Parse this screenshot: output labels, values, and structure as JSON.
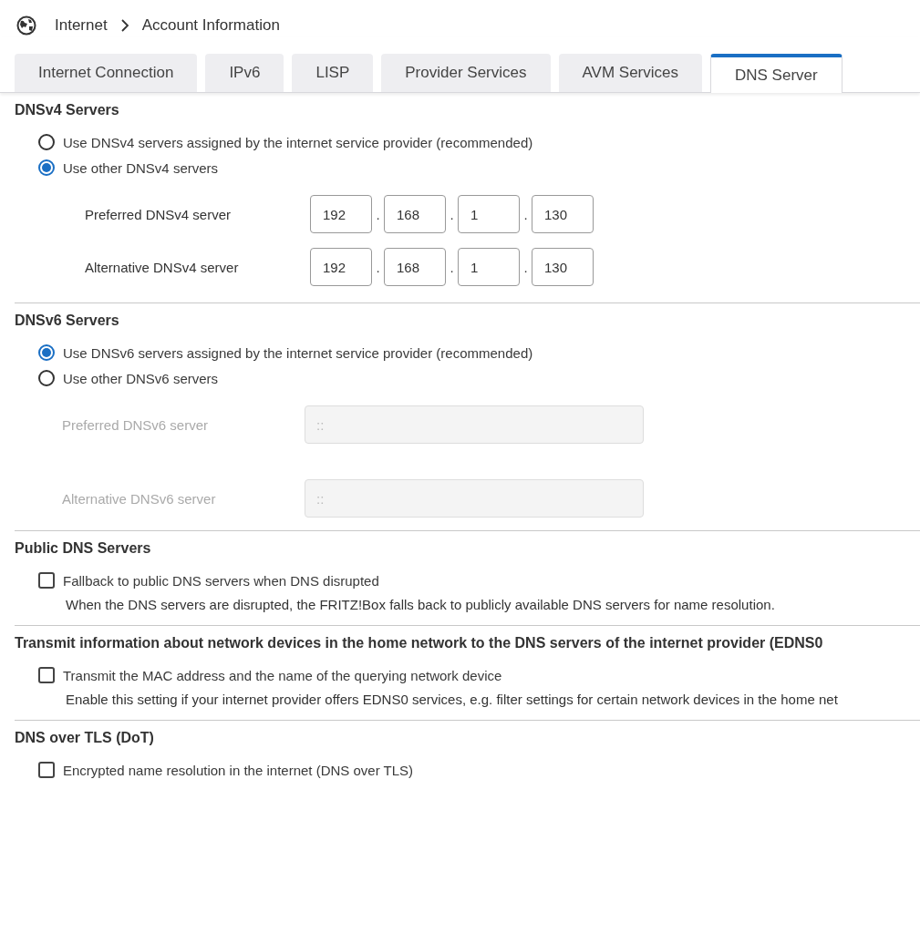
{
  "breadcrumb": [
    "Internet",
    "Account Information"
  ],
  "tabs": [
    {
      "label": "Internet Connection",
      "selected": false
    },
    {
      "label": "IPv6",
      "selected": false
    },
    {
      "label": "LISP",
      "selected": false
    },
    {
      "label": "Provider Services",
      "selected": false
    },
    {
      "label": "AVM Services",
      "selected": false
    },
    {
      "label": "DNS Server",
      "selected": true
    }
  ],
  "sections": [
    {
      "kind": "radio",
      "title": "DNSv4 Servers",
      "options": [
        {
          "label": "Use DNSv4 servers assigned by the internet service provider (recommended)",
          "selected": false
        },
        {
          "label": "Use other DNSv4 servers",
          "selected": true
        }
      ],
      "servers": [
        {
          "kind": "ipv4",
          "label": "Preferred DNSv4 server",
          "disabled": false,
          "octets": [
            "192",
            "168",
            "1",
            "130"
          ],
          "separator": "."
        },
        {
          "kind": "ipv4",
          "label": "Alternative DNSv4 server",
          "disabled": false,
          "octets": [
            "192",
            "168",
            "1",
            "130"
          ],
          "separator": "."
        }
      ]
    },
    {
      "kind": "radio",
      "title": "DNSv6 Servers",
      "options": [
        {
          "label": "Use DNSv6 servers assigned by the internet service provider (recommended)",
          "selected": true
        },
        {
          "label": "Use other DNSv6 servers",
          "selected": false
        }
      ],
      "servers": [
        {
          "kind": "ipv6",
          "label": "Preferred DNSv6 server",
          "disabled": true,
          "placeholder": "::"
        },
        {
          "kind": "ipv6",
          "label": "Alternative DNSv6 server",
          "disabled": true,
          "placeholder": "::"
        }
      ]
    },
    {
      "kind": "checkbox",
      "title": "Public DNS Servers",
      "options": [
        {
          "label": "Fallback to public DNS servers when DNS disrupted",
          "checked": false,
          "description": "When the DNS servers are disrupted, the FRITZ!Box falls back to publicly available DNS servers for name resolution."
        }
      ]
    },
    {
      "kind": "checkbox",
      "title": "Transmit information about network devices in the home network to the DNS servers of the internet provider (EDNS0",
      "options": [
        {
          "label": "Transmit the MAC address and the name of the querying network device",
          "checked": false,
          "description": "Enable this setting if your internet provider offers EDNS0 services, e.g. filter settings for certain network devices in the home net"
        }
      ]
    },
    {
      "kind": "checkbox",
      "title": "DNS over TLS (DoT)",
      "options": [
        {
          "label": "Encrypted name resolution in the internet (DNS over TLS)",
          "checked": false
        }
      ]
    }
  ]
}
